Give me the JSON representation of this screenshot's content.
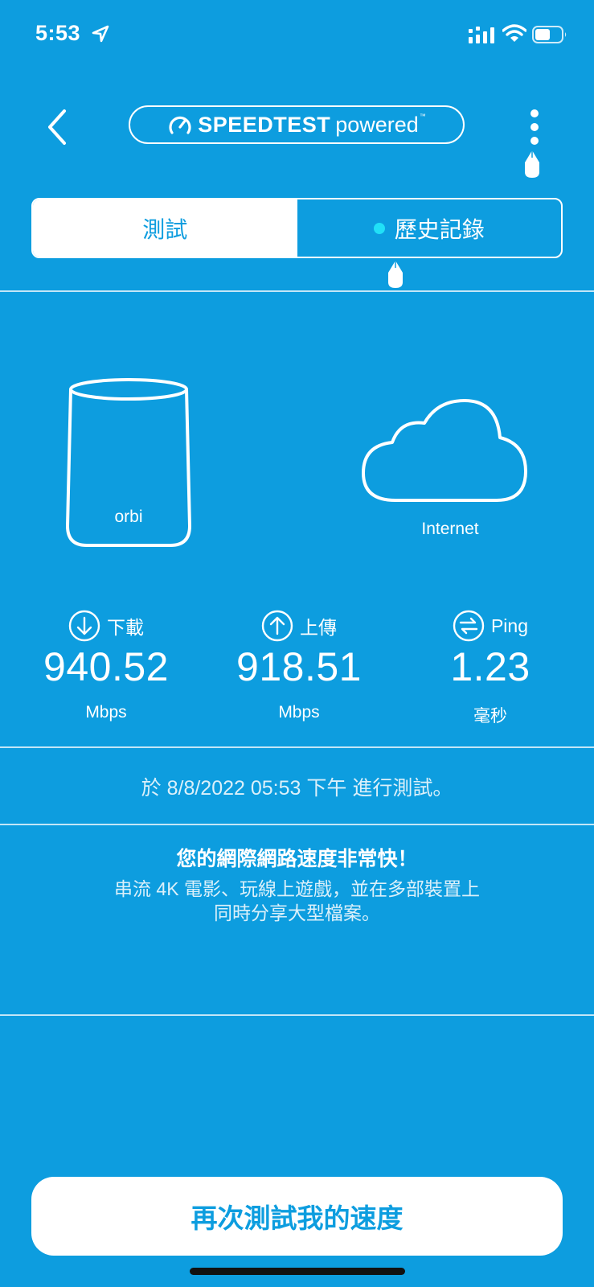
{
  "status_bar": {
    "time": "5:53"
  },
  "header": {
    "logo_brand": "SPEEDTEST",
    "logo_sub": "powered",
    "logo_tm": "™"
  },
  "tabs": [
    {
      "label": "測試",
      "active": true
    },
    {
      "label": "歷史記錄",
      "active": false
    }
  ],
  "devices": {
    "router_brand": "orbi",
    "internet_label": "Internet"
  },
  "metrics": {
    "download": {
      "label": "下載",
      "value": "940.52",
      "unit": "Mbps"
    },
    "upload": {
      "label": "上傳",
      "value": "918.51",
      "unit": "Mbps"
    },
    "ping": {
      "label": "Ping",
      "value": "1.23",
      "unit": "毫秒"
    }
  },
  "test_info": "於 8/8/2022 05:53 下午 進行測試。",
  "message": {
    "title": "您的網際網路速度非常快！",
    "line1": "串流 4K 電影、玩線上遊戲，並在多部裝置上",
    "line2": "同時分享大型檔案。"
  },
  "cta_label": "再次測試我的速度",
  "colors": {
    "background": "#0d9ddf",
    "accent_dot": "#21e0f7",
    "foreground": "#ffffff"
  },
  "icons": [
    "location-arrow-icon",
    "signal-icon",
    "wifi-icon",
    "battery-icon",
    "back-chevron-icon",
    "speedometer-icon",
    "more-vertical-icon",
    "router-icon",
    "cloud-icon",
    "download-arrow-icon",
    "upload-arrow-icon",
    "ping-arrows-icon"
  ]
}
